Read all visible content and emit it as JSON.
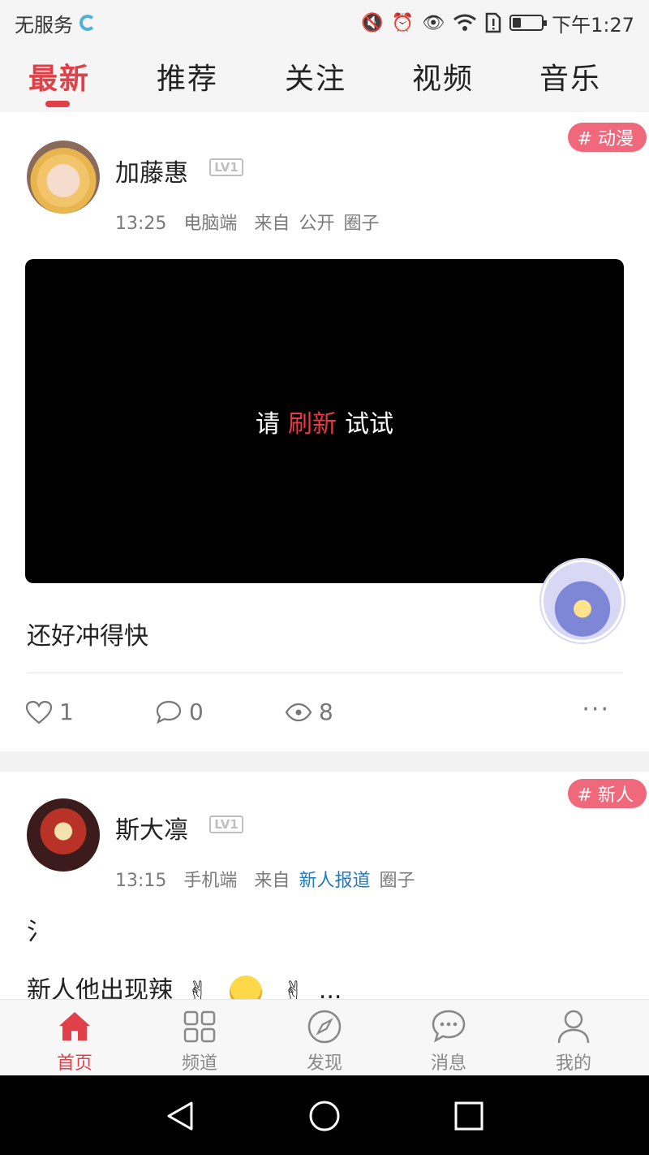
{
  "status_bar": {
    "carrier": "无服务",
    "time": "下午1:27",
    "icons": [
      "mute-icon",
      "alarm-icon",
      "eye-icon",
      "wifi-icon",
      "sim-alert-icon",
      "battery-icon"
    ],
    "battery_level": 0.3
  },
  "top_tabs": [
    {
      "label": "最新",
      "active": true
    },
    {
      "label": "推荐",
      "active": false
    },
    {
      "label": "关注",
      "active": false
    },
    {
      "label": "视频",
      "active": false
    },
    {
      "label": "音乐",
      "active": false
    }
  ],
  "colors": {
    "accent": "#e04048",
    "tag_bg": "#f0687c",
    "link_blue": "#1f7ac1"
  },
  "posts": [
    {
      "tag": "# 动漫",
      "username": "加藤惠",
      "level": "LV1",
      "time": "13:25",
      "device": "电脑端",
      "from_label": "来自",
      "circle_name": "公开",
      "circle_suffix": "圈子",
      "video_msg": {
        "pre": "请",
        "highlight": "刷新",
        "post": "试试"
      },
      "text": "还好冲得快",
      "likes": "1",
      "comments": "0",
      "views": "8",
      "more": "···"
    },
    {
      "tag": "# 新人",
      "username": "斯大凛",
      "level": "LV1",
      "time": "13:15",
      "device": "手机端",
      "from_label": "来自",
      "circle_name": "新人报道",
      "circle_suffix": "圈子",
      "text_line1": "氵",
      "text_line2": "新人他出现辣",
      "ellipsis": "..."
    }
  ],
  "bottom_nav": [
    {
      "label": "首页",
      "icon": "home-icon",
      "active": true
    },
    {
      "label": "频道",
      "icon": "grid-icon",
      "active": false
    },
    {
      "label": "发现",
      "icon": "compass-icon",
      "active": false
    },
    {
      "label": "消息",
      "icon": "chat-icon",
      "active": false
    },
    {
      "label": "我的",
      "icon": "user-icon",
      "active": false
    }
  ]
}
